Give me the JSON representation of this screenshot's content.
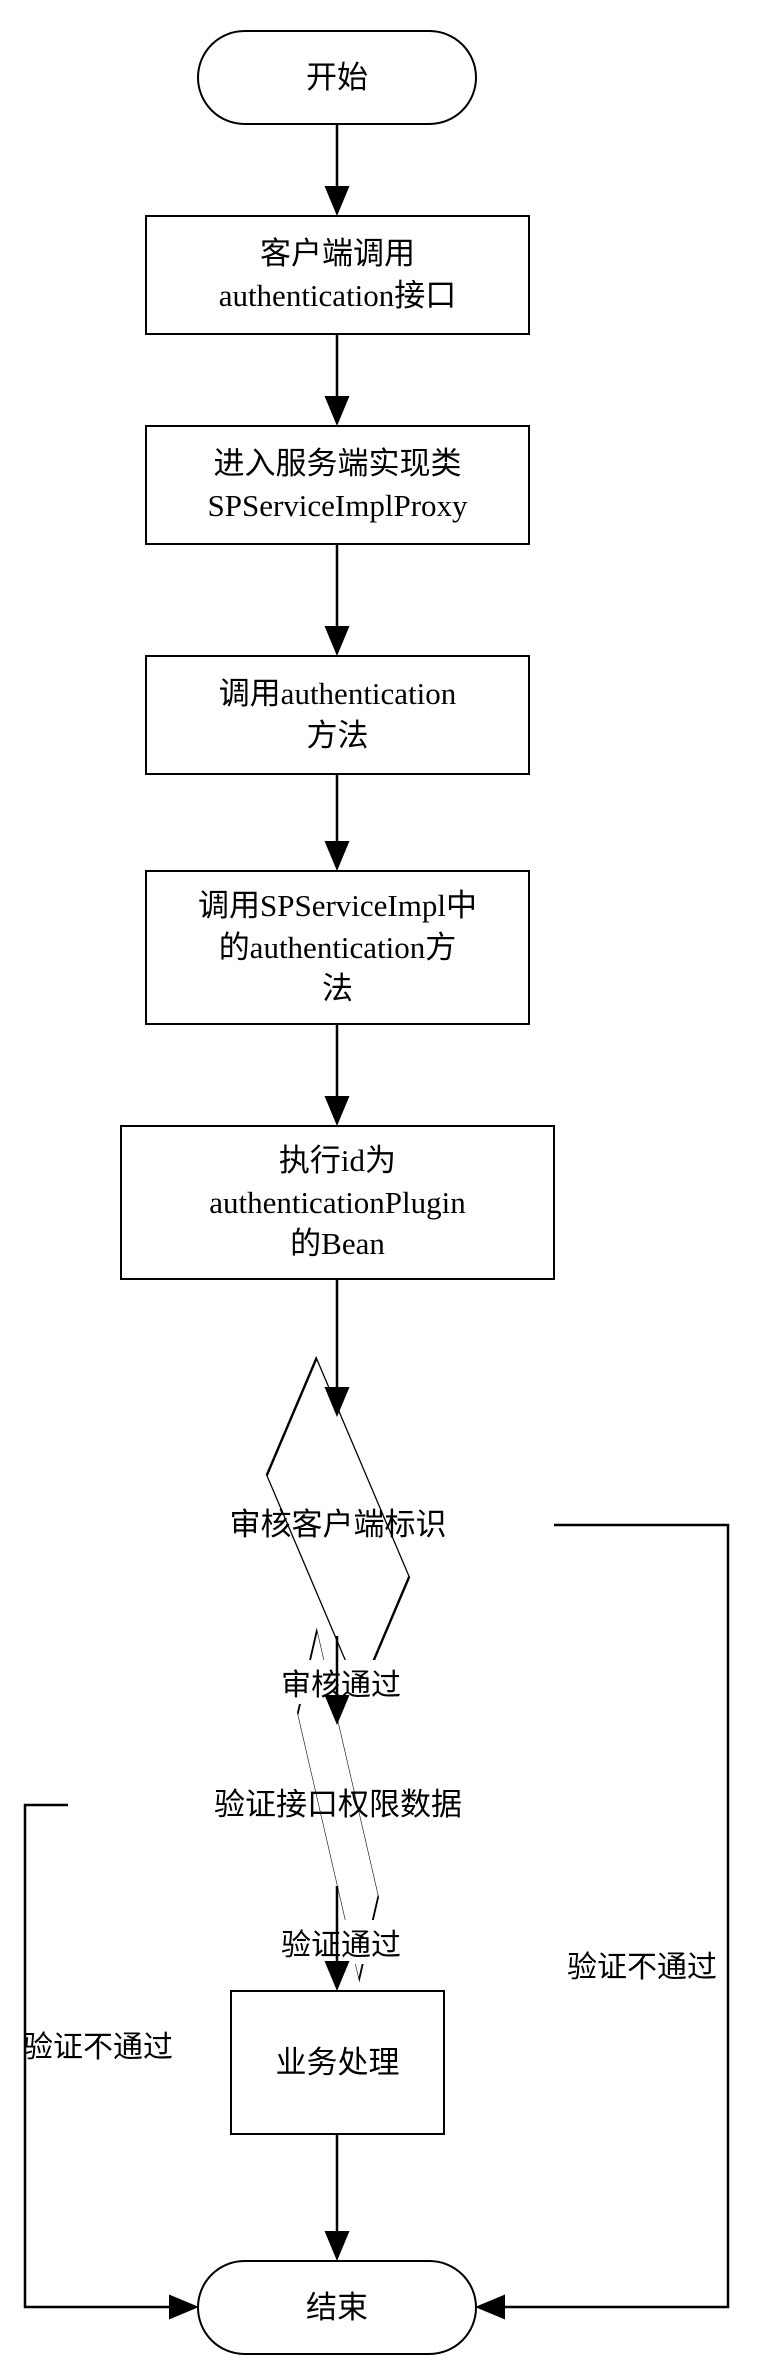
{
  "flowchart": {
    "start": {
      "label": "开始"
    },
    "end": {
      "label": "结束"
    },
    "steps": {
      "s1": {
        "label": "客户端调用\nauthentication接口"
      },
      "s2": {
        "label": "进入服务端实现类\nSPServiceImplProxy"
      },
      "s3": {
        "label": "调用authentication\n方法"
      },
      "s4": {
        "label": "调用SPServiceImpl中\n的authentication方\n法"
      },
      "s5": {
        "label": "执行id为\nauthenticationPlugin\n的Bean"
      },
      "s6": {
        "label": "业务处理"
      }
    },
    "decisions": {
      "d1": {
        "label": "审核客户端标识"
      },
      "d2": {
        "label": "验证接口权限数据"
      }
    },
    "edges": {
      "d1_pass": "审核通过",
      "d1_fail": "验证不通过",
      "d2_pass": "验证通过",
      "d2_fail": "验证不通过"
    }
  }
}
